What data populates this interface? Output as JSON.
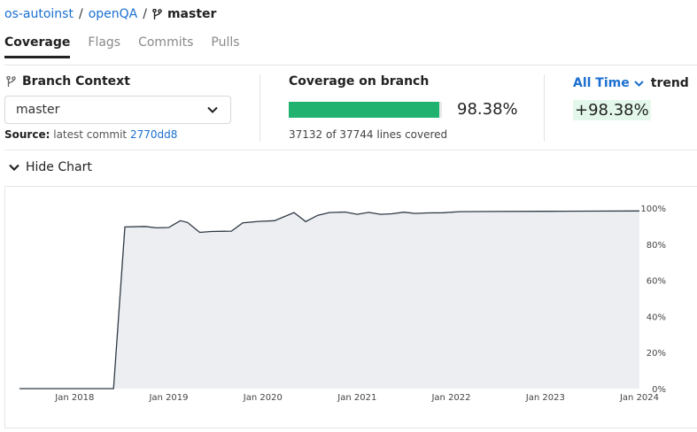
{
  "breadcrumb": {
    "owner": "os-autoinst",
    "repo": "openQA",
    "separator": "/",
    "branch": "master",
    "branch_icon": "git-branch-icon"
  },
  "tabs": [
    {
      "label": "Coverage",
      "active": true
    },
    {
      "label": "Flags",
      "active": false
    },
    {
      "label": "Commits",
      "active": false
    },
    {
      "label": "Pulls",
      "active": false
    }
  ],
  "branch_context": {
    "title": "Branch Context",
    "icon": "git-branch-icon",
    "selected": "master",
    "source_label": "Source:",
    "source_text": "latest commit",
    "commit": "2770dd8"
  },
  "coverage": {
    "title": "Coverage on branch",
    "percent_value": 98.38,
    "percent_text": "98.38%",
    "lines_text": "37132 of 37744 lines covered",
    "bar_color": "#21b26f"
  },
  "trend": {
    "range": "All Time",
    "label": "trend",
    "value": "+98.38%"
  },
  "chart_toggle": {
    "label": "Hide Chart"
  },
  "chart_data": {
    "type": "area",
    "title": "",
    "xlabel": "",
    "ylabel": "",
    "ylim": [
      0,
      100
    ],
    "xlim": [
      "2017-06-01",
      "2024-01-01"
    ],
    "y_ticks": [
      "0%",
      "20%",
      "40%",
      "60%",
      "80%",
      "100%"
    ],
    "x_ticks": [
      "Jan 2018",
      "Jan 2019",
      "Jan 2020",
      "Jan 2021",
      "Jan 2022",
      "Jan 2023",
      "Jan 2024"
    ],
    "line_color": "#2f3a45",
    "fill_color": "#eceef2",
    "grid": false,
    "series": [
      {
        "points": [
          [
            "2017-06-01",
            0
          ],
          [
            "2018-06-01",
            0
          ],
          [
            "2018-07-15",
            89.5
          ],
          [
            "2018-10-01",
            89.8
          ],
          [
            "2018-11-15",
            89.0
          ],
          [
            "2019-01-01",
            89.2
          ],
          [
            "2019-02-15",
            93.0
          ],
          [
            "2019-03-15",
            92.0
          ],
          [
            "2019-05-01",
            86.5
          ],
          [
            "2019-06-15",
            87.0
          ],
          [
            "2019-09-01",
            87.2
          ],
          [
            "2019-10-15",
            91.8
          ],
          [
            "2019-12-15",
            92.6
          ],
          [
            "2020-02-15",
            93.0
          ],
          [
            "2020-05-01",
            97.5
          ],
          [
            "2020-06-15",
            92.5
          ],
          [
            "2020-08-01",
            96.0
          ],
          [
            "2020-09-15",
            97.5
          ],
          [
            "2020-11-15",
            97.8
          ],
          [
            "2021-01-01",
            96.5
          ],
          [
            "2021-02-15",
            97.6
          ],
          [
            "2021-04-01",
            96.5
          ],
          [
            "2021-05-15",
            96.8
          ],
          [
            "2021-07-01",
            97.7
          ],
          [
            "2021-08-15",
            97.0
          ],
          [
            "2021-10-01",
            97.3
          ],
          [
            "2021-12-01",
            97.4
          ],
          [
            "2022-02-01",
            98.0
          ],
          [
            "2022-06-01",
            98.1
          ],
          [
            "2023-01-01",
            98.2
          ],
          [
            "2023-07-01",
            98.3
          ],
          [
            "2024-01-01",
            98.38
          ]
        ]
      }
    ]
  }
}
